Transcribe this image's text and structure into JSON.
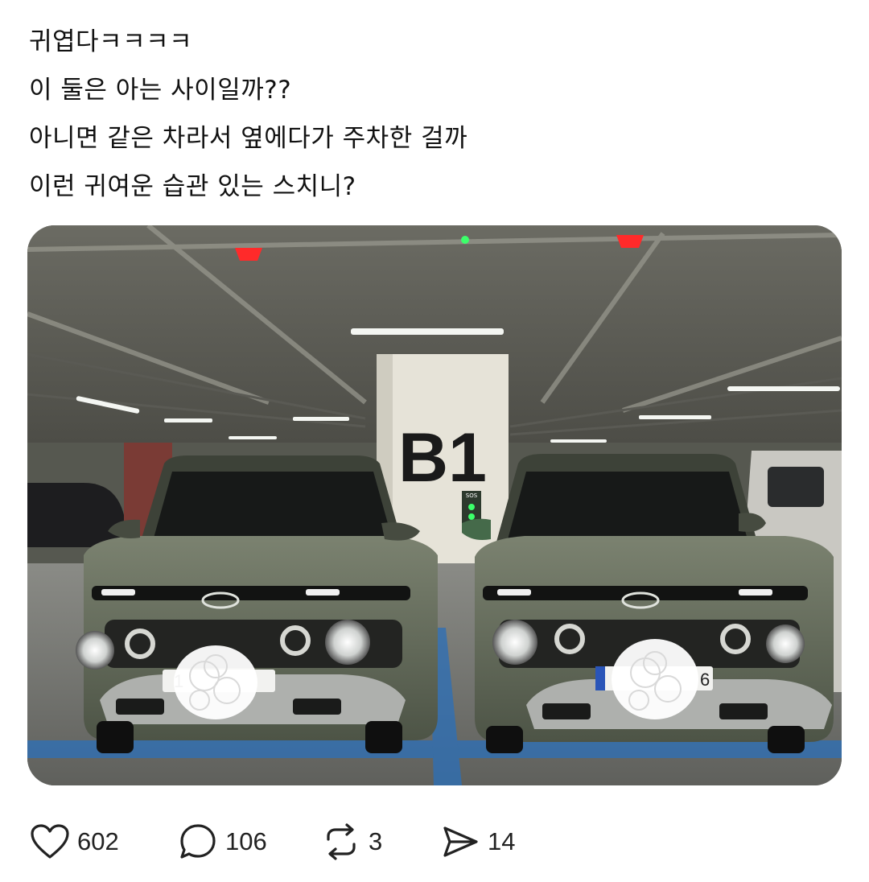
{
  "post": {
    "lines": [
      "귀엽다ㅋㅋㅋㅋ",
      "이 둘은 아는 사이일까??",
      "아니면 같은 차라서 옆에다가 주차한 걸까",
      "이런 귀여운 습관 있는 스치니?"
    ]
  },
  "photo": {
    "pillar_sign": "B1",
    "sos_label": "SOS",
    "plate_left": "1",
    "plate_right": "6"
  },
  "actions": {
    "like_count": "602",
    "reply_count": "106",
    "repost_count": "3",
    "share_count": "14"
  },
  "colors": {
    "text": "#111111",
    "icon": "#222222",
    "car_body": "#6d7461",
    "sign_text": "#1a1a1a"
  },
  "icons": [
    "heart-icon",
    "comment-icon",
    "repost-icon",
    "share-icon"
  ]
}
